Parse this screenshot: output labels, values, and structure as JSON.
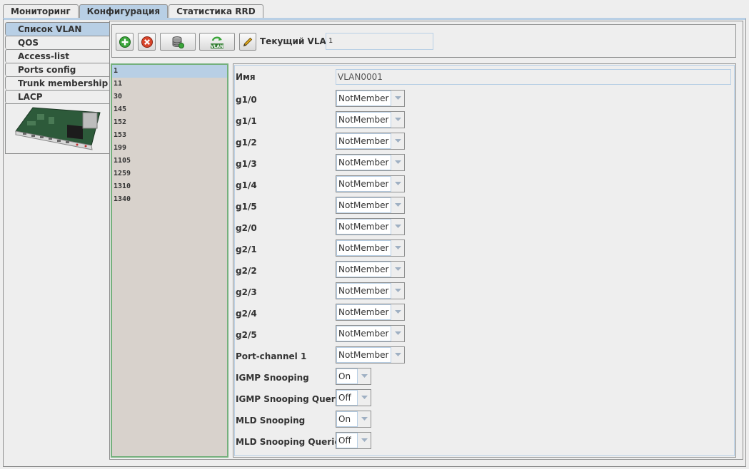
{
  "top_tabs": [
    {
      "label": "Мониторинг",
      "active": false
    },
    {
      "label": "Конфигурация",
      "active": true
    },
    {
      "label": "Статистика RRD",
      "active": false
    }
  ],
  "side_tabs": [
    {
      "label": "Список VLAN",
      "active": true
    },
    {
      "label": "QOS",
      "active": false
    },
    {
      "label": "Access-list",
      "active": false
    },
    {
      "label": "Ports config",
      "active": false
    },
    {
      "label": "Trunk membership",
      "active": false
    },
    {
      "label": "LACP",
      "active": false
    }
  ],
  "toolbar": {
    "buttons": [
      "add-icon",
      "delete-icon",
      "database-icon",
      "vlan-refresh-icon",
      "pencil-icon"
    ],
    "vlan_refresh_text": "VLAN",
    "current_vlan_label": "Текущий VLAN:",
    "current_vlan_value": "1"
  },
  "vlan_list": {
    "items": [
      "1",
      "11",
      "30",
      "145",
      "152",
      "153",
      "199",
      "1105",
      "1259",
      "1310",
      "1340"
    ],
    "selected": "1"
  },
  "form": {
    "name_label": "Имя",
    "name_value": "VLAN0001",
    "ports": [
      {
        "label": "g1/0",
        "value": "NotMember"
      },
      {
        "label": "g1/1",
        "value": "NotMember"
      },
      {
        "label": "g1/2",
        "value": "NotMember"
      },
      {
        "label": "g1/3",
        "value": "NotMember"
      },
      {
        "label": "g1/4",
        "value": "NotMember"
      },
      {
        "label": "g1/5",
        "value": "NotMember"
      },
      {
        "label": "g2/0",
        "value": "NotMember"
      },
      {
        "label": "g2/1",
        "value": "NotMember"
      },
      {
        "label": "g2/2",
        "value": "NotMember"
      },
      {
        "label": "g2/3",
        "value": "NotMember"
      },
      {
        "label": "g2/4",
        "value": "NotMember"
      },
      {
        "label": "g2/5",
        "value": "NotMember"
      },
      {
        "label": "Port-channel 1",
        "value": "NotMember"
      }
    ],
    "options": [
      {
        "label": "IGMP Snooping",
        "value": "On"
      },
      {
        "label": "IGMP Snooping Querier",
        "value": "Off"
      },
      {
        "label": "MLD Snooping",
        "value": "On"
      },
      {
        "label": "MLD Snooping Querier",
        "value": "Off"
      }
    ]
  },
  "colors": {
    "selection": "#b8cfe5",
    "list_border": "#74b07c",
    "list_bg": "#d8d2cc",
    "add_green": "#3aa53a",
    "delete_red": "#d9452b"
  }
}
